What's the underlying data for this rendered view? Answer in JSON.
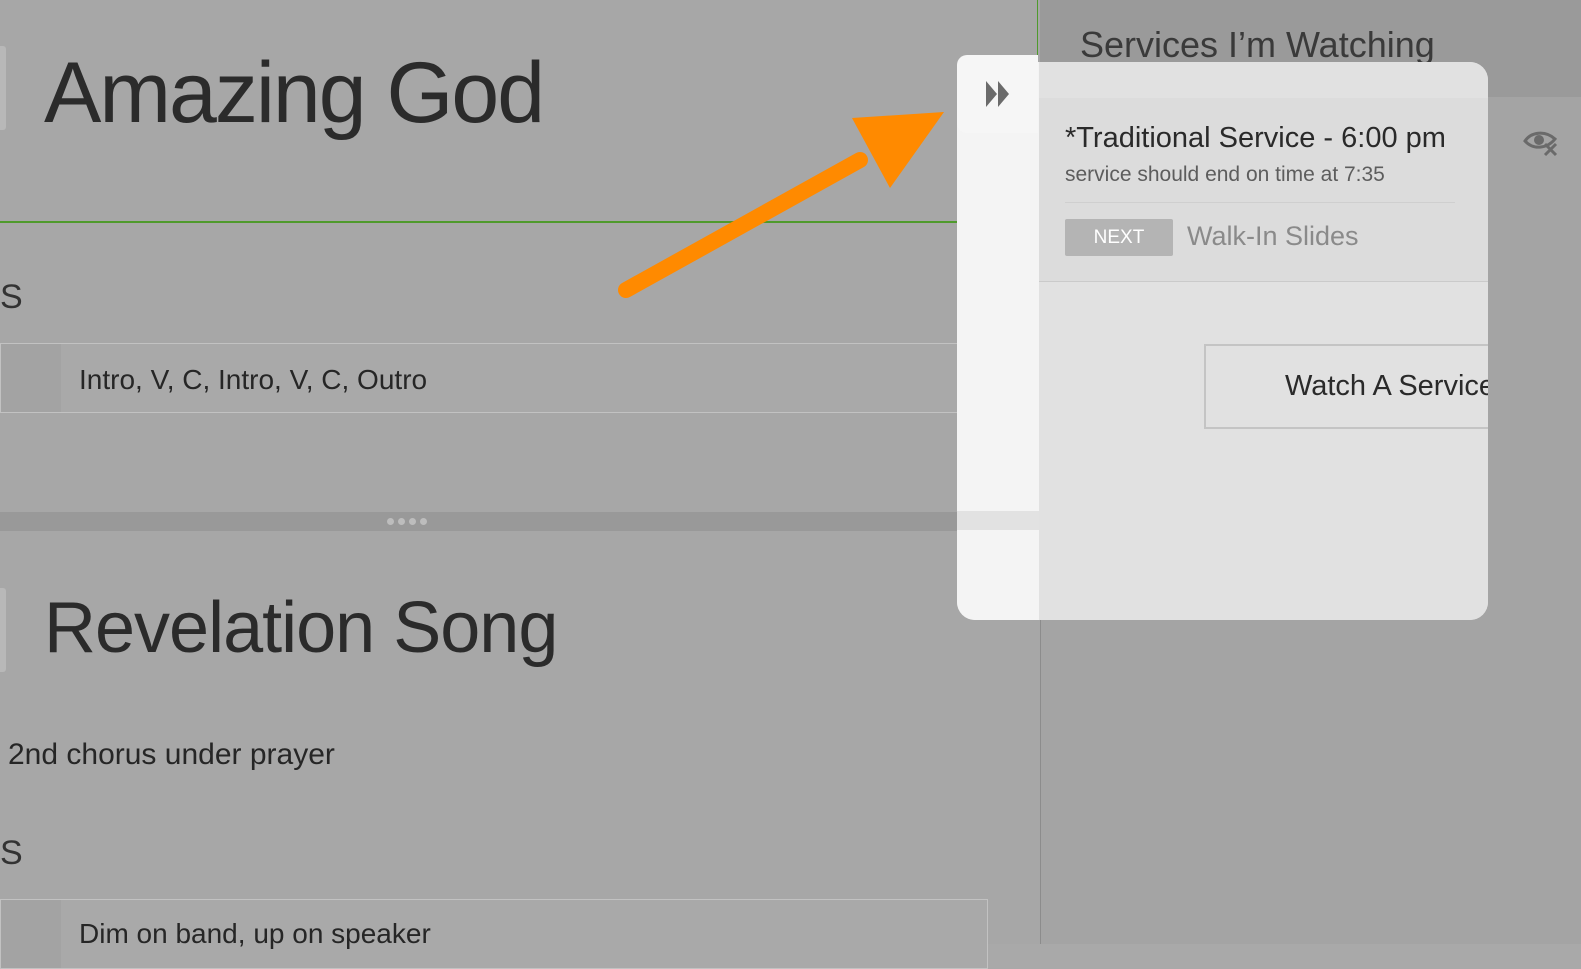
{
  "left": {
    "songs": [
      {
        "title": "Amazing God",
        "label": "S",
        "sequence": "Intro, V, C, Intro, V, C, Outro"
      },
      {
        "title": "Revelation Song",
        "note": "2nd chorus under prayer",
        "label": "S",
        "sequence": "Dim on band, up on speaker"
      }
    ]
  },
  "sidebar": {
    "title": "Services I’m Watching",
    "service": {
      "name": "*Traditional Service - 6:00 pm",
      "status": "service should end on time at 7:35",
      "next_badge": "NEXT",
      "next_item": "Walk-In Slides"
    },
    "watch_button": "Watch A Service"
  },
  "icons": {
    "collapse": "fast-forward-icon",
    "unwatch": "eye-x-icon"
  },
  "colors": {
    "accent_green": "#4f9a2c",
    "annotation_arrow": "#ff8a00"
  }
}
